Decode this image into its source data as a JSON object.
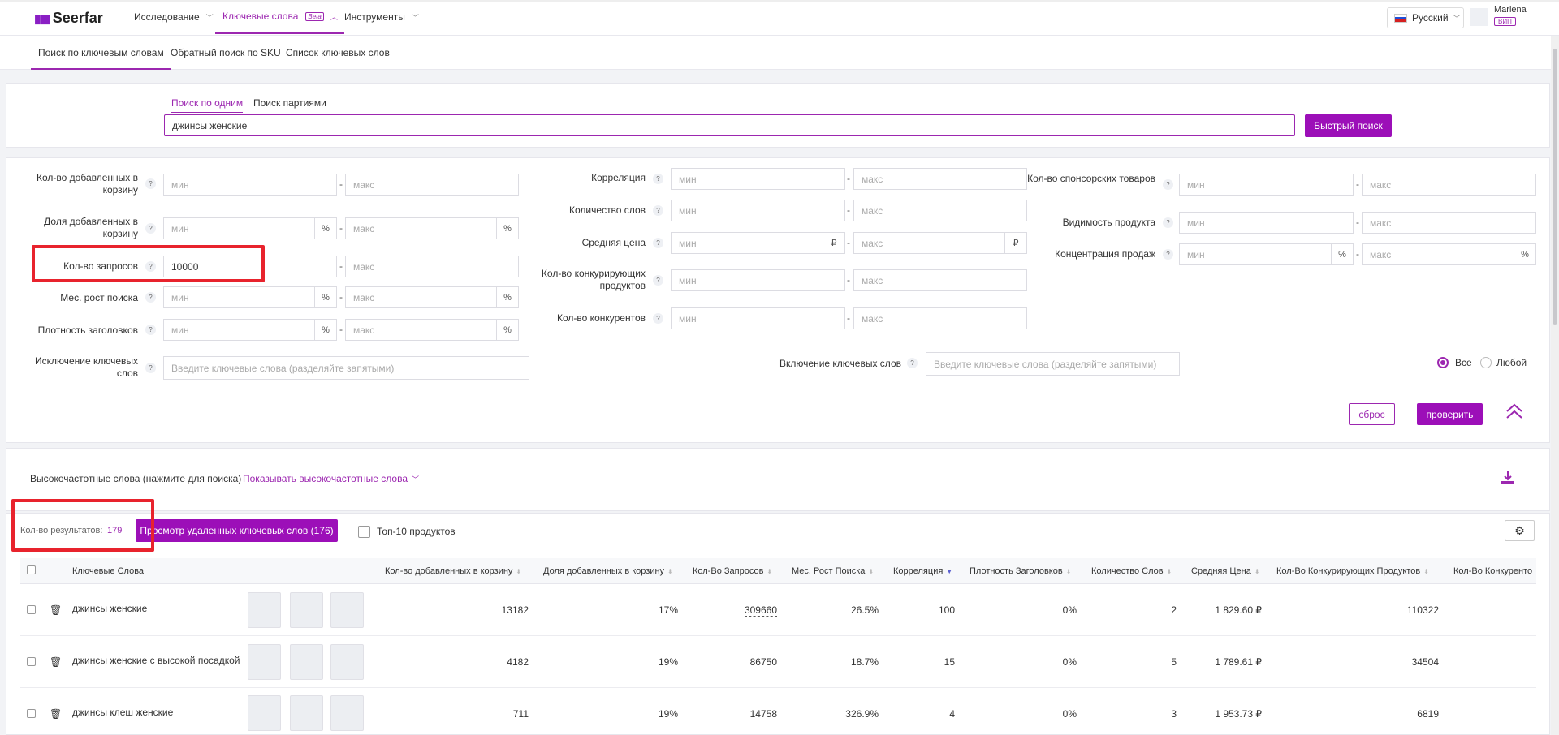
{
  "app": {
    "logo": "Seerfar",
    "nav": [
      {
        "label": "Исследование"
      },
      {
        "label": "Ключевые слова",
        "badge": "Beta"
      },
      {
        "label": "Инструменты"
      }
    ],
    "language": "Русский",
    "user": {
      "name": "Marlena",
      "badge": "ВИП"
    }
  },
  "subnav": [
    "Поиск по ключевым словам",
    "Обратный поиск по SKU",
    "Список ключевых слов"
  ],
  "search": {
    "tabs": [
      "Поиск по одним",
      "Поиск партиями"
    ],
    "query": "джинсы женские",
    "button": "Быстрый поиск"
  },
  "filters": {
    "min": "мин",
    "max": "макс",
    "percent": "%",
    "ruble": "₽",
    "help": "?",
    "col1": [
      {
        "label": "Кол-во добавленных в корзину",
        "min": ""
      },
      {
        "label": "Доля добавленных в корзину",
        "min": ""
      },
      {
        "label": "Кол-во запросов",
        "min": "10000"
      },
      {
        "label": "Мес. рост поиска",
        "min": ""
      },
      {
        "label": "Плотность заголовков",
        "min": ""
      }
    ],
    "col2": [
      {
        "label": "Корреляция"
      },
      {
        "label": "Количество слов"
      },
      {
        "label": "Средняя цена"
      },
      {
        "label": "Кол-во конкурирующих продуктов"
      },
      {
        "label": "Кол-во конкурентов"
      }
    ],
    "col3": [
      {
        "label": "Кол-во спонсорских товаров"
      },
      {
        "label": "Видимость продукта"
      },
      {
        "label": "Концентрация продаж"
      }
    ],
    "exclude_label": "Исключение ключевых слов",
    "include_label": "Включение ключевых слов",
    "keywords_placeholder": "Введите ключевые слова (разделяйте запятыми)",
    "radio_all": "Все",
    "radio_any": "Любой",
    "reset": "сброс",
    "check": "проверить"
  },
  "hf": {
    "label": "Высокочастотные слова (нажмите для поиска)",
    "toggle": "Показывать высокочастотные слова"
  },
  "results": {
    "count_label": "Кол-во результатов:",
    "count": "179",
    "deleted_button": "Просмотр удаленных ключевых слов (176)",
    "top10": "Топ-10 продуктов"
  },
  "table": {
    "headers": [
      "Ключевые Слова",
      "Кол-во добавленных в корзину",
      "Доля добавленных в корзину",
      "Кол-Во Запросов",
      "Мес. Рост Поиска",
      "Корреляция",
      "Плотность Заголовков",
      "Количество Слов",
      "Средняя Цена",
      "Кол-Во Конкурирующих Продуктов",
      "Кол-Во Конкуренто"
    ],
    "rows": [
      {
        "keyword": "джинсы женские",
        "cart": "13182",
        "share": "17%",
        "queries": "309660",
        "growth": "26.5%",
        "corr": "100",
        "density": "0%",
        "words": "2",
        "price": "1 829.60 ₽",
        "competing": "110322"
      },
      {
        "keyword": "джинсы женские с высокой посадкой",
        "cart": "4182",
        "share": "19%",
        "queries": "86750",
        "growth": "18.7%",
        "corr": "15",
        "density": "0%",
        "words": "5",
        "price": "1 789.61 ₽",
        "competing": "34504"
      },
      {
        "keyword": "джинсы клеш женские",
        "cart": "711",
        "share": "19%",
        "queries": "14758",
        "growth": "326.9%",
        "corr": "4",
        "density": "0%",
        "words": "3",
        "price": "1 953.73 ₽",
        "competing": "6819"
      }
    ]
  },
  "colors": {
    "accent": "#9c0fb8",
    "highlight": "#e8232d"
  }
}
